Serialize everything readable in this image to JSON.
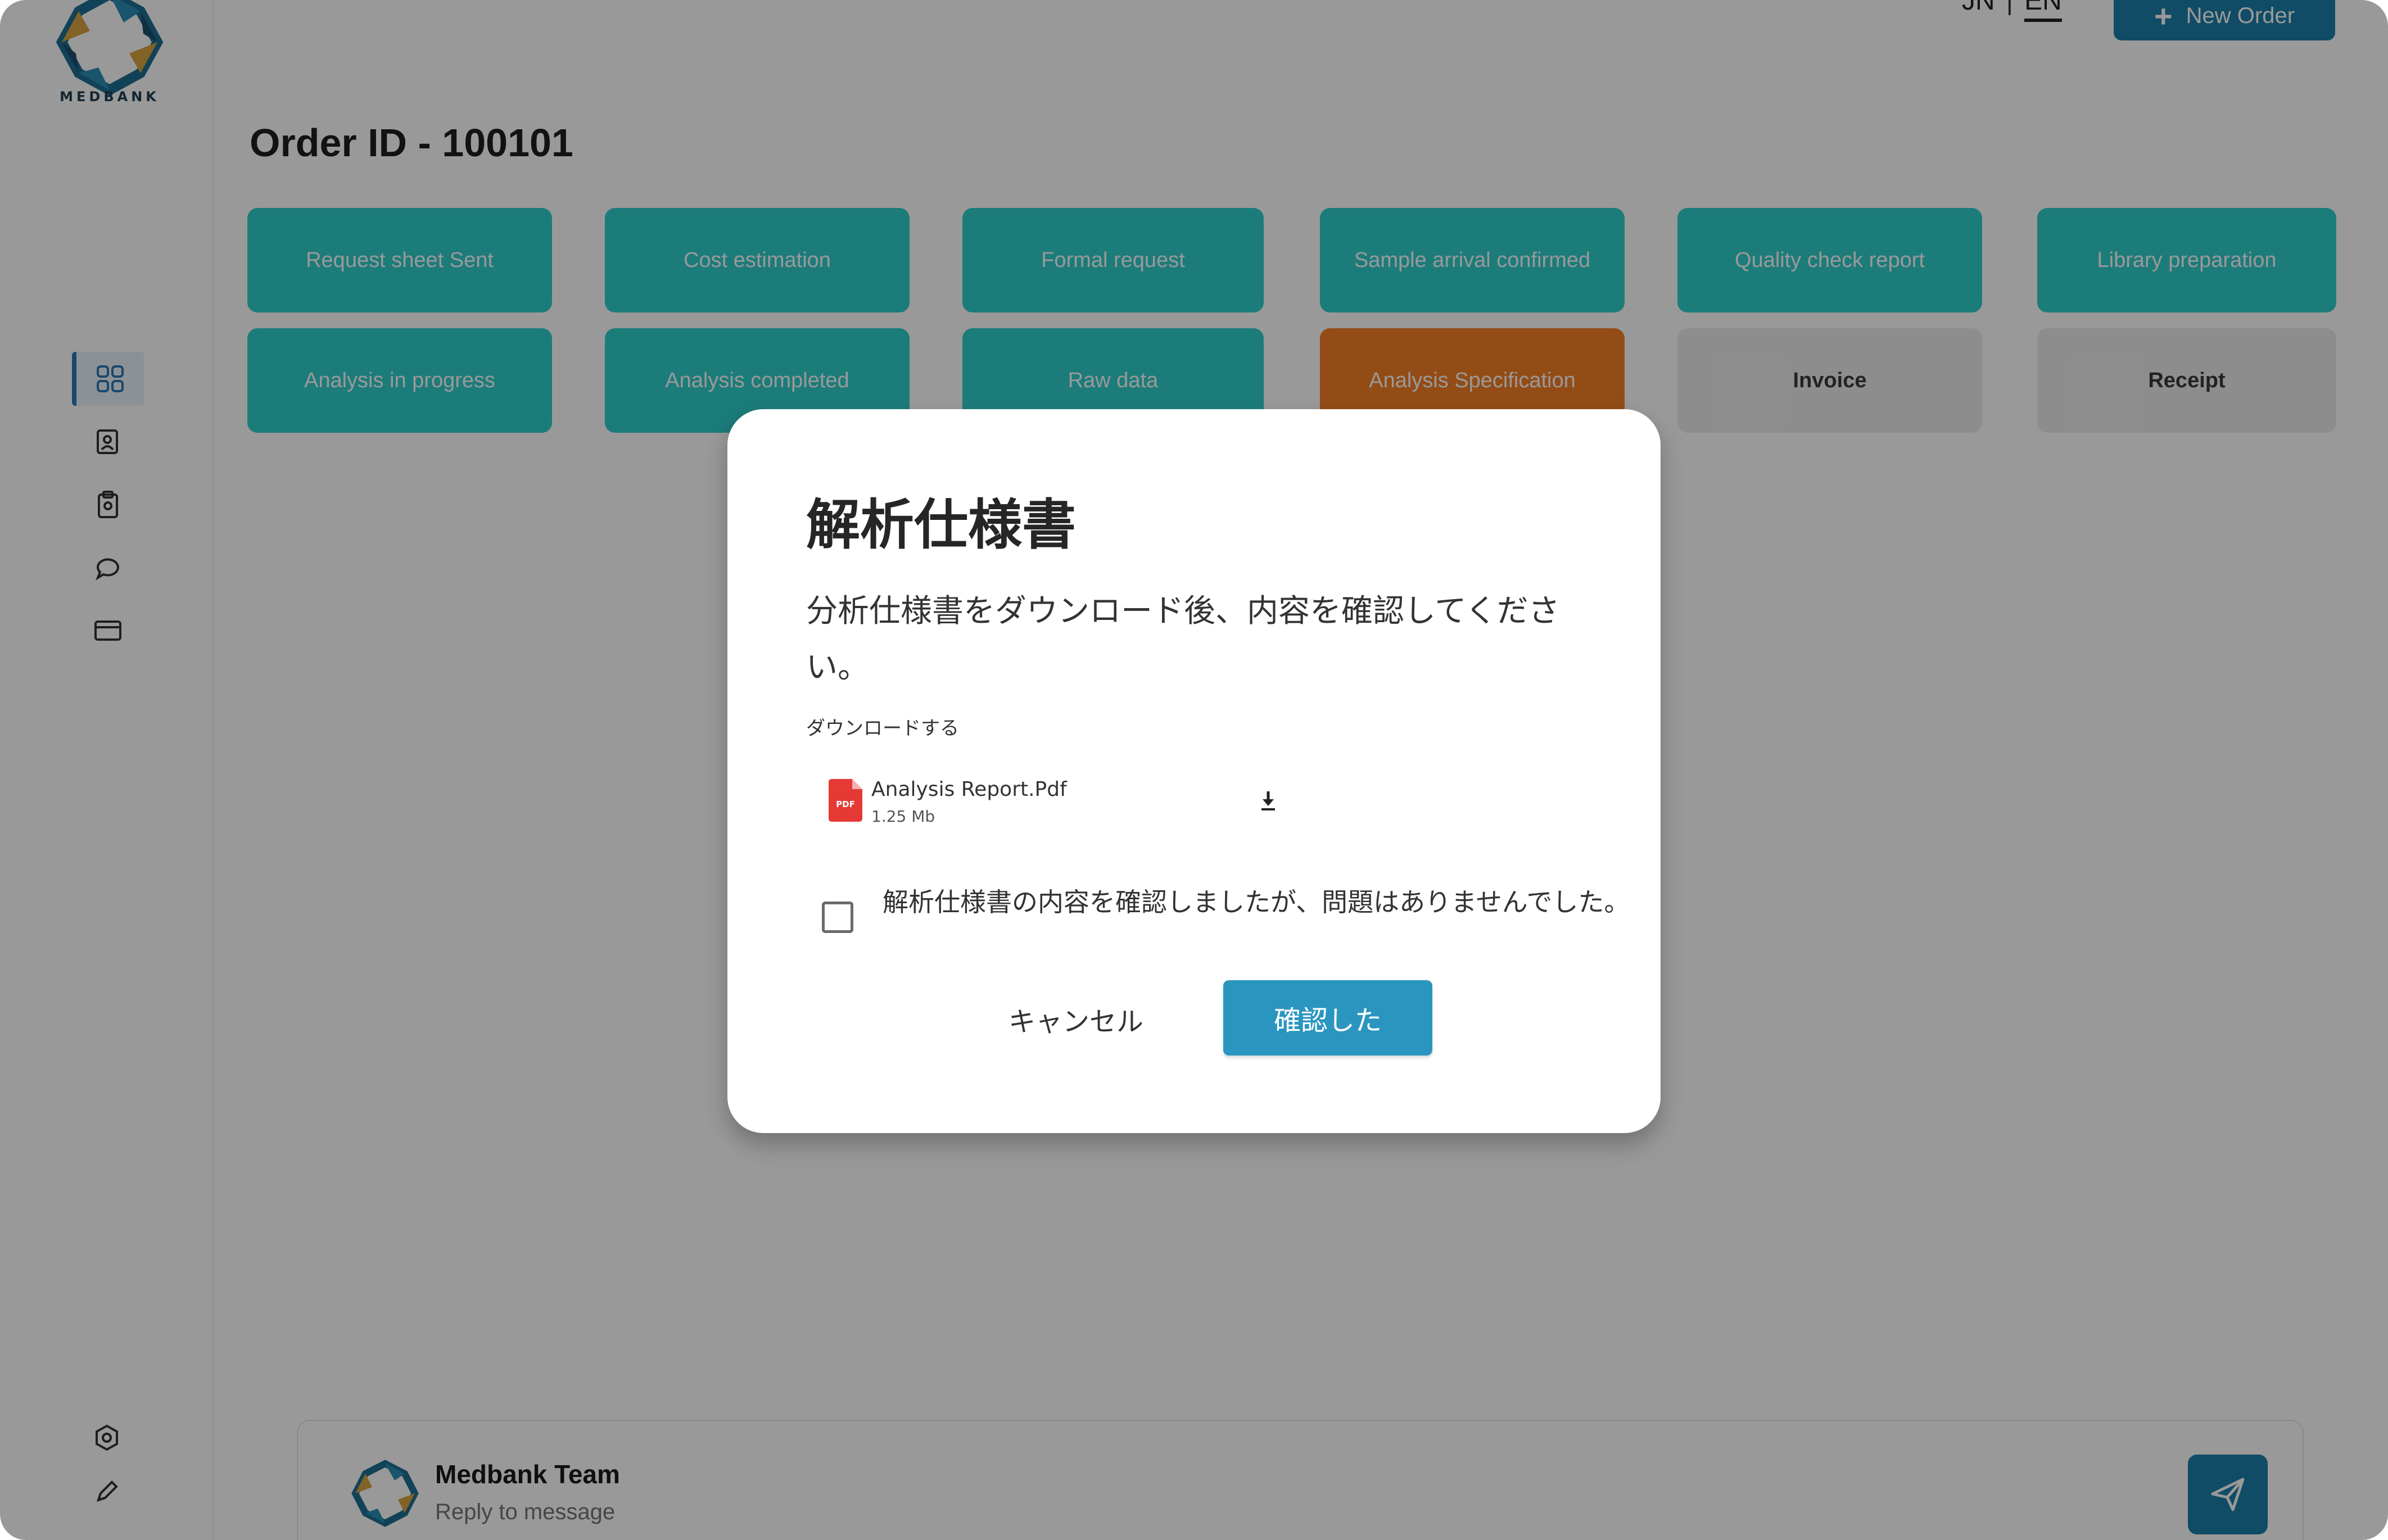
{
  "header": {
    "lang_jn": "JN",
    "lang_sep": "|",
    "lang_en": "EN",
    "new_order_label": "New Order",
    "new_order_icon": "plus-icon"
  },
  "brand": {
    "logo_text": "MEDBANK"
  },
  "sidebar": {
    "items": [
      {
        "icon": "dashboard-grid-icon",
        "active": true
      },
      {
        "icon": "user-profile-icon",
        "active": false
      },
      {
        "icon": "clipboard-icon",
        "active": false
      },
      {
        "icon": "chat-bubble-icon",
        "active": false
      },
      {
        "icon": "card-icon",
        "active": false
      }
    ],
    "bottom_items": [
      {
        "icon": "settings-gear-icon"
      },
      {
        "icon": "edit-pencil-icon"
      }
    ]
  },
  "order": {
    "title": "Order ID - 100101"
  },
  "steps": [
    {
      "label": "Request sheet Sent",
      "status": "done"
    },
    {
      "label": "Cost estimation",
      "status": "done"
    },
    {
      "label": "Formal request",
      "status": "done"
    },
    {
      "label": "Sample arrival confirmed",
      "status": "done"
    },
    {
      "label": "Quality check report",
      "status": "done"
    },
    {
      "label": "Library preparation",
      "status": "done"
    },
    {
      "label": "Analysis in progress",
      "status": "done"
    },
    {
      "label": "Analysis completed",
      "status": "done"
    },
    {
      "label": "Raw data",
      "status": "done"
    },
    {
      "label": "Analysis Specification",
      "status": "current"
    },
    {
      "label": "Invoice",
      "status": "pending"
    },
    {
      "label": "Receipt",
      "status": "pending"
    }
  ],
  "chat": {
    "team_name": "Medbank Team",
    "placeholder": "Reply to message"
  },
  "modal": {
    "title": "解析仕様書",
    "description": "分析仕様書をダウンロード後、内容を確認してください。",
    "download_label": "ダウンロードする",
    "file": {
      "name": "Analysis Report.Pdf",
      "size": "1.25 Mb",
      "type_badge": "PDF"
    },
    "checkbox_label": "解析仕様書の内容を確認しましたが、問題はありませんでした。",
    "cancel_label": "キャンセル",
    "confirm_label": "確認した"
  },
  "colors": {
    "step_done": "#2fcfcc",
    "step_current": "#f57f23",
    "step_pending": "#ececec",
    "primary": "#1c7fa8",
    "confirm_button": "#2a96c0",
    "pdf_red": "#e53935"
  }
}
